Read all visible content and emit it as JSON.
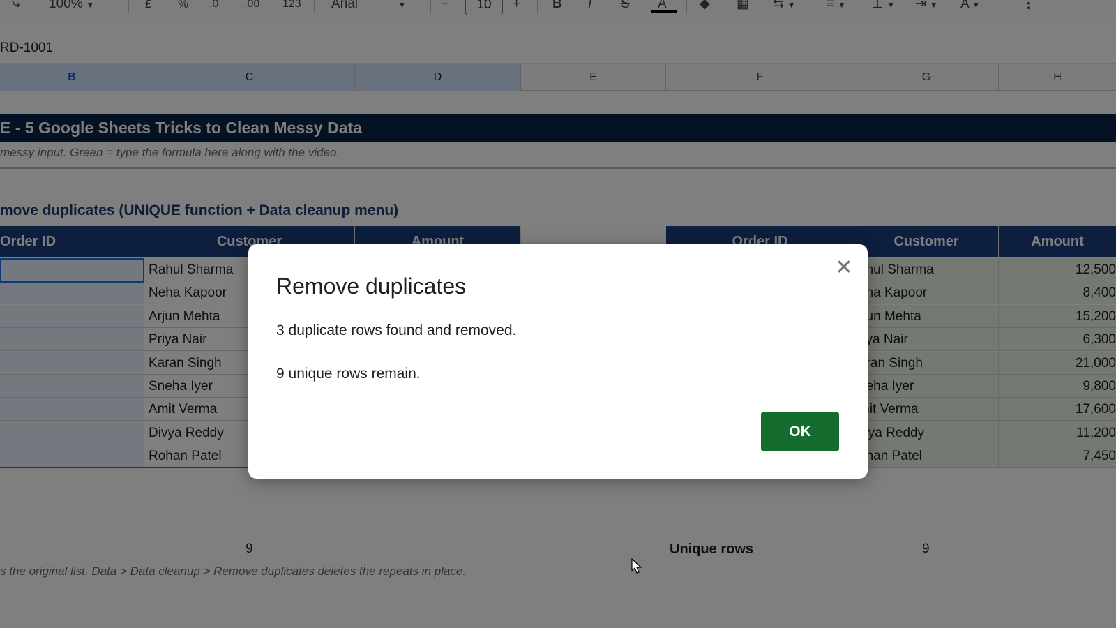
{
  "toolbar": {
    "zoom": "100%",
    "currency": "£",
    "percent": "%",
    "dec_decrease": ".0",
    "dec_increase": ".00",
    "number_format": "123",
    "font": "Arial",
    "font_size": "10",
    "minus": "−",
    "plus": "+",
    "bold": "B",
    "italic": "I",
    "strikethrough": "S",
    "text_color": "A",
    "more": "⋮"
  },
  "name_box": "RD-1001",
  "columns": [
    "B",
    "C",
    "D",
    "E",
    "F",
    "G",
    "H"
  ],
  "sheet": {
    "title": "E  -  5 Google Sheets Tricks to Clean Messy Data",
    "subtitle": "messy input.  Green = type the formula here along with the video.",
    "section_title": "move duplicates (UNIQUE function + Data cleanup menu)",
    "left_table": {
      "headers": [
        "Order ID",
        "Customer",
        "Amount"
      ],
      "customers": [
        "Rahul Sharma",
        "Neha Kapoor",
        "Arjun Mehta",
        "Priya Nair",
        "Karan Singh",
        "Sneha Iyer",
        "Amit Verma",
        "Divya Reddy",
        "Rohan Patel"
      ]
    },
    "right_table": {
      "headers": [
        "Order ID",
        "Customer",
        "Amount"
      ],
      "customers": [
        "ahul Sharma",
        "eha Kapoor",
        "rjun Mehta",
        "riya Nair",
        "aran Singh",
        "neha Iyer",
        "mit Verma",
        "ivya Reddy",
        "ohan Patel"
      ],
      "amounts": [
        "12,500",
        "8,400",
        "15,200",
        "6,300",
        "21,000",
        "9,800",
        "17,600",
        "11,200",
        "7,450"
      ]
    },
    "left_count": "9",
    "unique_label": "Unique rows",
    "unique_count": "9",
    "footnote": "s the original list.  Data > Data cleanup > Remove duplicates deletes the repeats in place."
  },
  "dialog": {
    "title": "Remove duplicates",
    "line1": "3 duplicate rows found and removed.",
    "line2": "9 unique rows remain.",
    "ok_label": "OK",
    "close_icon": "close-icon"
  },
  "colors": {
    "title_bar": "#0b2447",
    "header_fill": "#1a3d7c",
    "green_fill": "#e9f3e3",
    "ok_button": "#146c2e"
  }
}
